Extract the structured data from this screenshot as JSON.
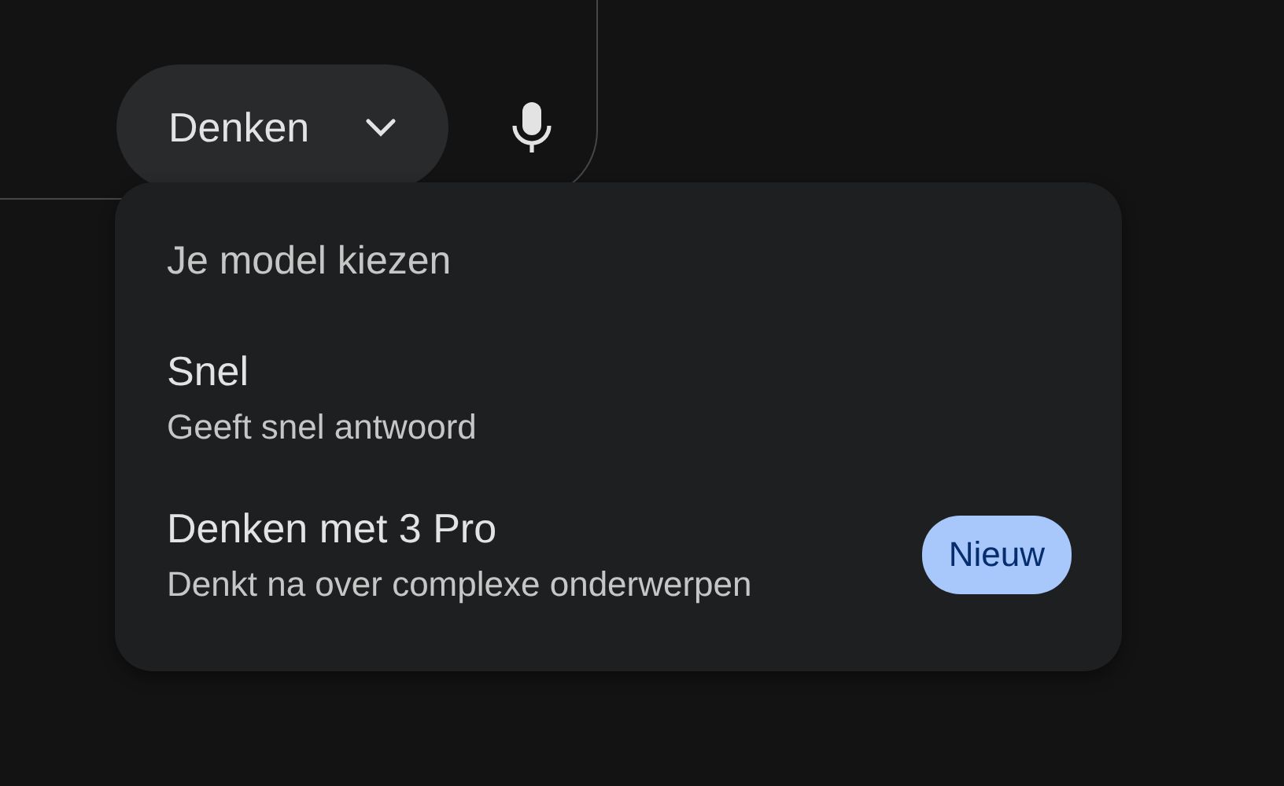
{
  "model_button": {
    "label": "Denken"
  },
  "menu": {
    "title": "Je model kiezen",
    "items": [
      {
        "title": "Snel",
        "subtitle": "Geeft snel antwoord"
      },
      {
        "title": "Denken met 3 Pro",
        "subtitle": "Denkt na over complexe onderwerpen",
        "badge": "Nieuw"
      }
    ]
  }
}
